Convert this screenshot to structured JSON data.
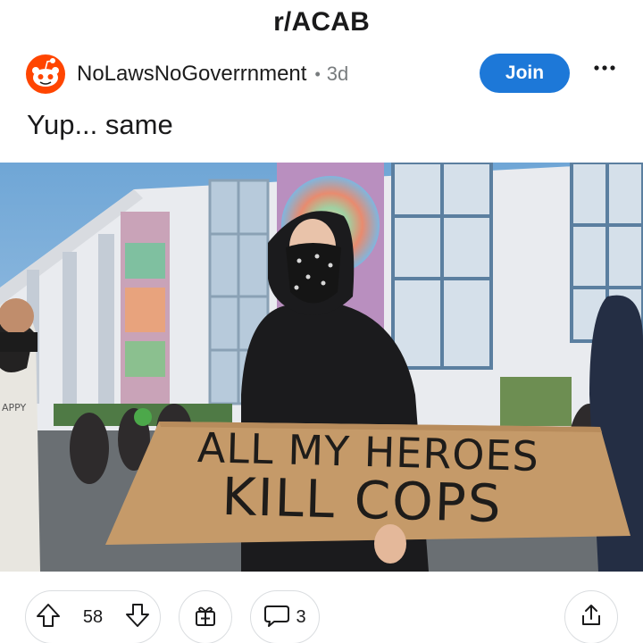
{
  "header": {
    "subreddit": "r/ACAB"
  },
  "post": {
    "username": "NoLawsNoGoverrnment",
    "separator": "•",
    "age": "3d",
    "join_label": "Join",
    "title": "Yup... same",
    "image": {
      "sign_line_1": "ALL MY HEROES",
      "sign_line_2": "KILL COPS",
      "shirt_text": "APPY"
    }
  },
  "actions": {
    "upvotes": "58",
    "comments": "3"
  },
  "colors": {
    "join_button": "#1d78d8",
    "avatar_accent": "#ff4500"
  },
  "icons": [
    "reddit-avatar-icon",
    "more-options-icon",
    "upvote-icon",
    "downvote-icon",
    "award-icon",
    "comment-icon",
    "share-icon"
  ]
}
